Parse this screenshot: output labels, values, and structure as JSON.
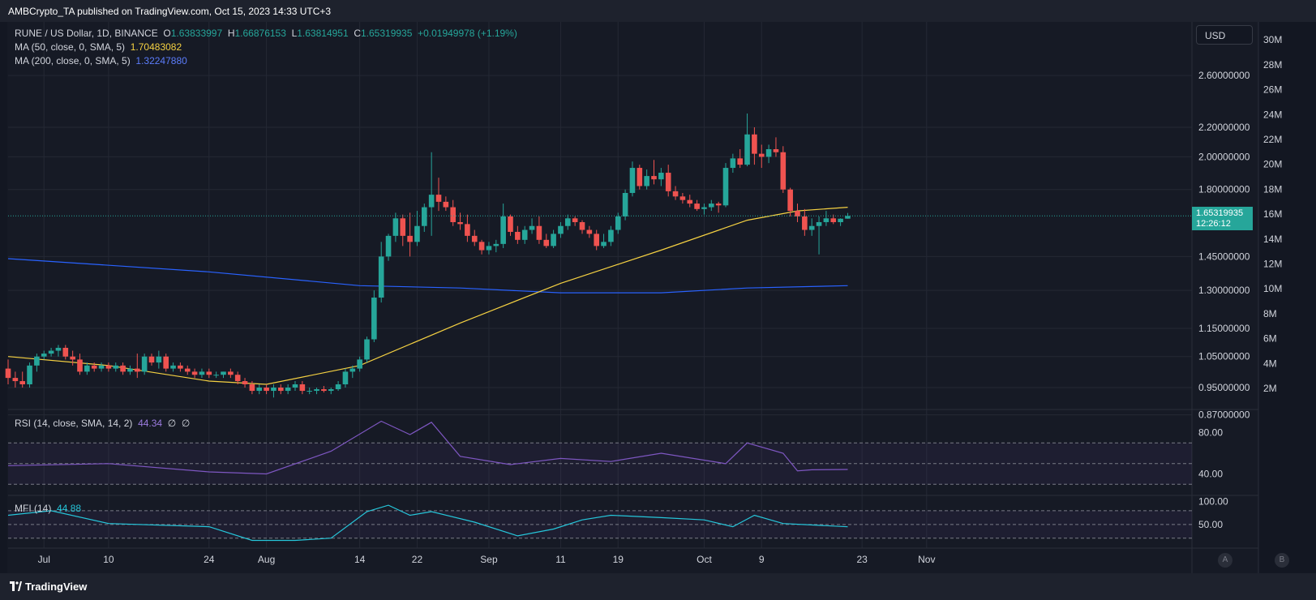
{
  "header": {
    "published_text": "AMBCrypto_TA published on TradingView.com, Oct 15, 2023 14:33 UTC+3"
  },
  "legend": {
    "symbol": "RUNE / US Dollar, 1D, BINANCE",
    "o_label": "O",
    "o_value": "1.63833997",
    "h_label": "H",
    "h_value": "1.66876153",
    "l_label": "L",
    "l_value": "1.63814951",
    "c_label": "C",
    "c_value": "1.65319935",
    "change": "+0.01949978 (+1.19%)",
    "ma50_label": "MA (50, close, 0, SMA, 5)",
    "ma50_value": "1.70483082",
    "ma200_label": "MA (200, close, 0, SMA, 5)",
    "ma200_value": "1.32247880"
  },
  "rsi_legend": {
    "label": "RSI (14, close, SMA, 14, 2)",
    "value": "44.34",
    "extra1": "∅",
    "extra2": "∅"
  },
  "mfi_legend": {
    "label": "MFI (14)",
    "value": "44.88"
  },
  "currency_button": "USD",
  "last_price": {
    "price": "1.65319935",
    "countdown": "12:26:12"
  },
  "footer": {
    "logo_text": "TradingView"
  },
  "scale_buttons": {
    "a": "A",
    "b": "B"
  },
  "colors": {
    "up": "#26a69a",
    "down": "#ef5350",
    "ma50": "#f5d142",
    "ma200": "#2962ff",
    "rsi": "#7e57c2",
    "mfi": "#26c6da",
    "background": "#161a25"
  },
  "chart_data": {
    "type": "candlestick",
    "price_axis": {
      "ticks": [
        0.87,
        0.95,
        1.05,
        1.15,
        1.3,
        1.45,
        1.8,
        2.0,
        2.2,
        2.6
      ],
      "scale": "log"
    },
    "volume_axis": {
      "ticks": [
        "2M",
        "4M",
        "6M",
        "8M",
        "10M",
        "12M",
        "14M",
        "16M",
        "18M",
        "20M",
        "22M",
        "24M",
        "26M",
        "28M",
        "30M"
      ]
    },
    "x_axis": {
      "labels": [
        "Jul",
        "10",
        "24",
        "Aug",
        "14",
        "22",
        "Sep",
        "11",
        "19",
        "Oct",
        "9",
        "23",
        "Nov"
      ]
    },
    "candles": [
      {
        "date": "2023-06-26",
        "o": 1.01,
        "h": 1.04,
        "l": 0.96,
        "c": 0.98
      },
      {
        "date": "2023-06-27",
        "o": 0.98,
        "h": 1.0,
        "l": 0.95,
        "c": 0.97
      },
      {
        "date": "2023-06-28",
        "o": 0.97,
        "h": 1.0,
        "l": 0.95,
        "c": 0.96
      },
      {
        "date": "2023-06-29",
        "o": 0.96,
        "h": 1.03,
        "l": 0.95,
        "c": 1.02
      },
      {
        "date": "2023-06-30",
        "o": 1.02,
        "h": 1.06,
        "l": 1.0,
        "c": 1.05
      },
      {
        "date": "2023-07-01",
        "o": 1.05,
        "h": 1.07,
        "l": 1.04,
        "c": 1.06
      },
      {
        "date": "2023-07-02",
        "o": 1.06,
        "h": 1.08,
        "l": 1.05,
        "c": 1.07
      },
      {
        "date": "2023-07-03",
        "o": 1.07,
        "h": 1.09,
        "l": 1.05,
        "c": 1.08
      },
      {
        "date": "2023-07-04",
        "o": 1.08,
        "h": 1.09,
        "l": 1.04,
        "c": 1.05
      },
      {
        "date": "2023-07-05",
        "o": 1.05,
        "h": 1.07,
        "l": 1.02,
        "c": 1.04
      },
      {
        "date": "2023-07-06",
        "o": 1.04,
        "h": 1.06,
        "l": 0.99,
        "c": 1.0
      },
      {
        "date": "2023-07-07",
        "o": 1.0,
        "h": 1.03,
        "l": 0.99,
        "c": 1.02
      },
      {
        "date": "2023-07-08",
        "o": 1.02,
        "h": 1.03,
        "l": 1.0,
        "c": 1.01
      },
      {
        "date": "2023-07-09",
        "o": 1.01,
        "h": 1.03,
        "l": 1.0,
        "c": 1.02
      },
      {
        "date": "2023-07-10",
        "o": 1.02,
        "h": 1.03,
        "l": 1.0,
        "c": 1.01
      },
      {
        "date": "2023-07-11",
        "o": 1.01,
        "h": 1.03,
        "l": 1.0,
        "c": 1.02
      },
      {
        "date": "2023-07-12",
        "o": 1.02,
        "h": 1.03,
        "l": 0.99,
        "c": 1.0
      },
      {
        "date": "2023-07-13",
        "o": 1.0,
        "h": 1.02,
        "l": 0.99,
        "c": 1.01
      },
      {
        "date": "2023-07-14",
        "o": 1.01,
        "h": 1.06,
        "l": 0.98,
        "c": 1.0
      },
      {
        "date": "2023-07-15",
        "o": 1.0,
        "h": 1.06,
        "l": 0.99,
        "c": 1.05
      },
      {
        "date": "2023-07-16",
        "o": 1.05,
        "h": 1.06,
        "l": 1.02,
        "c": 1.03
      },
      {
        "date": "2023-07-17",
        "o": 1.03,
        "h": 1.07,
        "l": 1.01,
        "c": 1.05
      },
      {
        "date": "2023-07-18",
        "o": 1.05,
        "h": 1.06,
        "l": 1.0,
        "c": 1.01
      },
      {
        "date": "2023-07-19",
        "o": 1.01,
        "h": 1.03,
        "l": 1.0,
        "c": 1.02
      },
      {
        "date": "2023-07-20",
        "o": 1.02,
        "h": 1.03,
        "l": 1.0,
        "c": 1.01
      },
      {
        "date": "2023-07-21",
        "o": 1.01,
        "h": 1.02,
        "l": 0.99,
        "c": 1.0
      },
      {
        "date": "2023-07-22",
        "o": 1.0,
        "h": 1.01,
        "l": 0.98,
        "c": 0.99
      },
      {
        "date": "2023-07-23",
        "o": 0.99,
        "h": 1.01,
        "l": 0.98,
        "c": 1.0
      },
      {
        "date": "2023-07-24",
        "o": 1.0,
        "h": 1.01,
        "l": 0.98,
        "c": 0.99
      },
      {
        "date": "2023-07-25",
        "o": 0.99,
        "h": 1.0,
        "l": 0.98,
        "c": 0.99
      },
      {
        "date": "2023-07-26",
        "o": 0.99,
        "h": 1.0,
        "l": 0.98,
        "c": 1.0
      },
      {
        "date": "2023-07-27",
        "o": 1.0,
        "h": 1.01,
        "l": 0.98,
        "c": 0.99
      },
      {
        "date": "2023-07-28",
        "o": 0.99,
        "h": 1.0,
        "l": 0.96,
        "c": 0.97
      },
      {
        "date": "2023-07-29",
        "o": 0.97,
        "h": 0.98,
        "l": 0.95,
        "c": 0.96
      },
      {
        "date": "2023-07-30",
        "o": 0.96,
        "h": 0.97,
        "l": 0.93,
        "c": 0.94
      },
      {
        "date": "2023-07-31",
        "o": 0.94,
        "h": 0.96,
        "l": 0.93,
        "c": 0.95
      },
      {
        "date": "2023-08-01",
        "o": 0.95,
        "h": 0.96,
        "l": 0.93,
        "c": 0.94
      },
      {
        "date": "2023-08-02",
        "o": 0.94,
        "h": 0.96,
        "l": 0.92,
        "c": 0.95
      },
      {
        "date": "2023-08-03",
        "o": 0.95,
        "h": 0.96,
        "l": 0.93,
        "c": 0.94
      },
      {
        "date": "2023-08-04",
        "o": 0.94,
        "h": 0.96,
        "l": 0.93,
        "c": 0.95
      },
      {
        "date": "2023-08-05",
        "o": 0.95,
        "h": 0.97,
        "l": 0.94,
        "c": 0.96
      },
      {
        "date": "2023-08-06",
        "o": 0.96,
        "h": 0.97,
        "l": 0.93,
        "c": 0.94
      },
      {
        "date": "2023-08-07",
        "o": 0.94,
        "h": 0.95,
        "l": 0.93,
        "c": 0.94
      },
      {
        "date": "2023-08-08",
        "o": 0.94,
        "h": 0.95,
        "l": 0.93,
        "c": 0.945
      },
      {
        "date": "2023-08-09",
        "o": 0.945,
        "h": 0.955,
        "l": 0.935,
        "c": 0.94
      },
      {
        "date": "2023-08-10",
        "o": 0.94,
        "h": 0.95,
        "l": 0.93,
        "c": 0.945
      },
      {
        "date": "2023-08-11",
        "o": 0.945,
        "h": 0.97,
        "l": 0.94,
        "c": 0.96
      },
      {
        "date": "2023-08-12",
        "o": 0.96,
        "h": 1.01,
        "l": 0.95,
        "c": 1.0
      },
      {
        "date": "2023-08-13",
        "o": 1.0,
        "h": 1.02,
        "l": 0.98,
        "c": 1.01
      },
      {
        "date": "2023-08-14",
        "o": 1.01,
        "h": 1.05,
        "l": 1.0,
        "c": 1.04
      },
      {
        "date": "2023-08-15",
        "o": 1.04,
        "h": 1.12,
        "l": 1.03,
        "c": 1.11
      },
      {
        "date": "2023-08-16",
        "o": 1.11,
        "h": 1.3,
        "l": 1.1,
        "c": 1.27
      },
      {
        "date": "2023-08-17",
        "o": 1.27,
        "h": 1.52,
        "l": 1.25,
        "c": 1.45
      },
      {
        "date": "2023-08-18",
        "o": 1.45,
        "h": 1.56,
        "l": 1.43,
        "c": 1.55
      },
      {
        "date": "2023-08-19",
        "o": 1.55,
        "h": 1.67,
        "l": 1.52,
        "c": 1.64
      },
      {
        "date": "2023-08-20",
        "o": 1.64,
        "h": 1.66,
        "l": 1.5,
        "c": 1.55
      },
      {
        "date": "2023-08-21",
        "o": 1.55,
        "h": 1.67,
        "l": 1.45,
        "c": 1.52
      },
      {
        "date": "2023-08-22",
        "o": 1.52,
        "h": 1.68,
        "l": 1.5,
        "c": 1.6
      },
      {
        "date": "2023-08-23",
        "o": 1.6,
        "h": 1.72,
        "l": 1.57,
        "c": 1.7
      },
      {
        "date": "2023-08-24",
        "o": 1.7,
        "h": 2.03,
        "l": 1.55,
        "c": 1.77
      },
      {
        "date": "2023-08-25",
        "o": 1.77,
        "h": 1.87,
        "l": 1.68,
        "c": 1.73
      },
      {
        "date": "2023-08-26",
        "o": 1.73,
        "h": 1.76,
        "l": 1.68,
        "c": 1.7
      },
      {
        "date": "2023-08-27",
        "o": 1.7,
        "h": 1.74,
        "l": 1.6,
        "c": 1.62
      },
      {
        "date": "2023-08-28",
        "o": 1.62,
        "h": 1.67,
        "l": 1.58,
        "c": 1.61
      },
      {
        "date": "2023-08-29",
        "o": 1.61,
        "h": 1.66,
        "l": 1.52,
        "c": 1.55
      },
      {
        "date": "2023-08-30",
        "o": 1.55,
        "h": 1.58,
        "l": 1.5,
        "c": 1.52
      },
      {
        "date": "2023-08-31",
        "o": 1.52,
        "h": 1.53,
        "l": 1.46,
        "c": 1.48
      },
      {
        "date": "2023-09-01",
        "o": 1.48,
        "h": 1.52,
        "l": 1.46,
        "c": 1.5
      },
      {
        "date": "2023-09-02",
        "o": 1.5,
        "h": 1.53,
        "l": 1.47,
        "c": 1.51
      },
      {
        "date": "2023-09-03",
        "o": 1.51,
        "h": 1.72,
        "l": 1.49,
        "c": 1.65
      },
      {
        "date": "2023-09-04",
        "o": 1.65,
        "h": 1.66,
        "l": 1.55,
        "c": 1.57
      },
      {
        "date": "2023-09-05",
        "o": 1.57,
        "h": 1.6,
        "l": 1.51,
        "c": 1.53
      },
      {
        "date": "2023-09-06",
        "o": 1.53,
        "h": 1.6,
        "l": 1.51,
        "c": 1.58
      },
      {
        "date": "2023-09-07",
        "o": 1.58,
        "h": 1.64,
        "l": 1.56,
        "c": 1.6
      },
      {
        "date": "2023-09-08",
        "o": 1.6,
        "h": 1.65,
        "l": 1.51,
        "c": 1.53
      },
      {
        "date": "2023-09-09",
        "o": 1.53,
        "h": 1.56,
        "l": 1.49,
        "c": 1.5
      },
      {
        "date": "2023-09-10",
        "o": 1.5,
        "h": 1.58,
        "l": 1.49,
        "c": 1.56
      },
      {
        "date": "2023-09-11",
        "o": 1.56,
        "h": 1.62,
        "l": 1.54,
        "c": 1.6
      },
      {
        "date": "2023-09-12",
        "o": 1.6,
        "h": 1.66,
        "l": 1.58,
        "c": 1.64
      },
      {
        "date": "2023-09-13",
        "o": 1.64,
        "h": 1.65,
        "l": 1.6,
        "c": 1.62
      },
      {
        "date": "2023-09-14",
        "o": 1.62,
        "h": 1.63,
        "l": 1.56,
        "c": 1.58
      },
      {
        "date": "2023-09-15",
        "o": 1.58,
        "h": 1.6,
        "l": 1.54,
        "c": 1.56
      },
      {
        "date": "2023-09-16",
        "o": 1.56,
        "h": 1.58,
        "l": 1.48,
        "c": 1.5
      },
      {
        "date": "2023-09-17",
        "o": 1.5,
        "h": 1.56,
        "l": 1.49,
        "c": 1.52
      },
      {
        "date": "2023-09-18",
        "o": 1.52,
        "h": 1.6,
        "l": 1.5,
        "c": 1.58
      },
      {
        "date": "2023-09-19",
        "o": 1.58,
        "h": 1.67,
        "l": 1.56,
        "c": 1.65
      },
      {
        "date": "2023-09-20",
        "o": 1.65,
        "h": 1.8,
        "l": 1.63,
        "c": 1.78
      },
      {
        "date": "2023-09-21",
        "o": 1.78,
        "h": 1.97,
        "l": 1.76,
        "c": 1.93
      },
      {
        "date": "2023-09-22",
        "o": 1.93,
        "h": 1.95,
        "l": 1.8,
        "c": 1.82
      },
      {
        "date": "2023-09-23",
        "o": 1.82,
        "h": 1.92,
        "l": 1.8,
        "c": 1.88
      },
      {
        "date": "2023-09-24",
        "o": 1.88,
        "h": 1.98,
        "l": 1.83,
        "c": 1.86
      },
      {
        "date": "2023-09-25",
        "o": 1.86,
        "h": 1.93,
        "l": 1.82,
        "c": 1.9
      },
      {
        "date": "2023-09-26",
        "o": 1.9,
        "h": 1.95,
        "l": 1.76,
        "c": 1.79
      },
      {
        "date": "2023-09-27",
        "o": 1.79,
        "h": 1.82,
        "l": 1.74,
        "c": 1.76
      },
      {
        "date": "2023-09-28",
        "o": 1.76,
        "h": 1.78,
        "l": 1.72,
        "c": 1.74
      },
      {
        "date": "2023-09-29",
        "o": 1.74,
        "h": 1.77,
        "l": 1.7,
        "c": 1.72
      },
      {
        "date": "2023-09-30",
        "o": 1.72,
        "h": 1.74,
        "l": 1.68,
        "c": 1.69
      },
      {
        "date": "2023-10-01",
        "o": 1.69,
        "h": 1.72,
        "l": 1.66,
        "c": 1.7
      },
      {
        "date": "2023-10-02",
        "o": 1.7,
        "h": 1.74,
        "l": 1.68,
        "c": 1.72
      },
      {
        "date": "2023-10-03",
        "o": 1.72,
        "h": 1.73,
        "l": 1.67,
        "c": 1.71
      },
      {
        "date": "2023-10-04",
        "o": 1.71,
        "h": 1.96,
        "l": 1.7,
        "c": 1.93
      },
      {
        "date": "2023-10-05",
        "o": 1.93,
        "h": 2.02,
        "l": 1.9,
        "c": 1.99
      },
      {
        "date": "2023-10-06",
        "o": 1.99,
        "h": 2.05,
        "l": 1.93,
        "c": 1.95
      },
      {
        "date": "2023-10-07",
        "o": 1.95,
        "h": 2.3,
        "l": 1.94,
        "c": 2.15
      },
      {
        "date": "2023-10-08",
        "o": 2.15,
        "h": 2.2,
        "l": 1.95,
        "c": 2.02
      },
      {
        "date": "2023-10-09",
        "o": 2.02,
        "h": 2.08,
        "l": 1.93,
        "c": 2.0
      },
      {
        "date": "2023-10-10",
        "o": 2.0,
        "h": 2.08,
        "l": 1.96,
        "c": 2.05
      },
      {
        "date": "2023-10-11",
        "o": 2.05,
        "h": 2.13,
        "l": 2.0,
        "c": 2.03
      },
      {
        "date": "2023-10-12",
        "o": 2.03,
        "h": 2.07,
        "l": 1.78,
        "c": 1.8
      },
      {
        "date": "2023-10-13",
        "o": 1.8,
        "h": 1.81,
        "l": 1.65,
        "c": 1.68
      },
      {
        "date": "2023-10-14",
        "o": 1.68,
        "h": 1.72,
        "l": 1.62,
        "c": 1.65
      },
      {
        "date": "2023-10-15",
        "o": 1.65,
        "h": 1.69,
        "l": 1.55,
        "c": 1.58
      },
      {
        "date": "2023-10-16",
        "o": 1.58,
        "h": 1.64,
        "l": 1.55,
        "c": 1.6
      },
      {
        "date": "2023-10-17",
        "o": 1.6,
        "h": 1.65,
        "l": 1.46,
        "c": 1.62
      },
      {
        "date": "2023-10-18",
        "o": 1.62,
        "h": 1.68,
        "l": 1.6,
        "c": 1.64
      },
      {
        "date": "2023-10-19",
        "o": 1.64,
        "h": 1.66,
        "l": 1.61,
        "c": 1.62
      },
      {
        "date": "2023-10-20",
        "o": 1.62,
        "h": 1.64,
        "l": 1.6,
        "c": 1.638
      },
      {
        "date": "2023-10-21",
        "o": 1.63834,
        "h": 1.66876,
        "l": 1.63815,
        "c": 1.6532
      }
    ],
    "series": [
      {
        "name": "MA (50, close, 0, SMA, 5)",
        "type": "line",
        "x": [
          "2023-06-26",
          "2023-07-10",
          "2023-07-24",
          "2023-08-01",
          "2023-08-14",
          "2023-08-28",
          "2023-09-11",
          "2023-09-25",
          "2023-10-07",
          "2023-10-14",
          "2023-10-21"
        ],
        "y": [
          1.05,
          1.02,
          0.97,
          0.96,
          1.02,
          1.17,
          1.33,
          1.48,
          1.63,
          1.68,
          1.7
        ]
      },
      {
        "name": "MA (200, close, 0, SMA, 5)",
        "type": "line",
        "x": [
          "2023-06-26",
          "2023-07-24",
          "2023-08-14",
          "2023-08-28",
          "2023-09-11",
          "2023-09-25",
          "2023-10-07",
          "2023-10-21"
        ],
        "y": [
          1.44,
          1.38,
          1.32,
          1.31,
          1.29,
          1.29,
          1.31,
          1.32
        ]
      },
      {
        "name": "RSI (14, close, SMA, 14, 2)",
        "type": "line",
        "ylim": [
          20,
          100
        ],
        "bands": [
          70,
          50,
          30
        ],
        "x": [
          "2023-06-26",
          "2023-07-10",
          "2023-07-24",
          "2023-08-01",
          "2023-08-10",
          "2023-08-17",
          "2023-08-21",
          "2023-08-24",
          "2023-08-28",
          "2023-09-04",
          "2023-09-11",
          "2023-09-18",
          "2023-09-25",
          "2023-10-04",
          "2023-10-07",
          "2023-10-12",
          "2023-10-14",
          "2023-10-16",
          "2023-10-21"
        ],
        "y": [
          48,
          50,
          42,
          40,
          62,
          91,
          78,
          90,
          57,
          49,
          55,
          52,
          60,
          50,
          70,
          60,
          43,
          44,
          44.34
        ]
      },
      {
        "name": "MFI (14)",
        "type": "line",
        "ylim": [
          0,
          110
        ],
        "bands": [
          80,
          50,
          20
        ],
        "x": [
          "2023-06-26",
          "2023-07-02",
          "2023-07-10",
          "2023-07-24",
          "2023-07-30",
          "2023-08-05",
          "2023-08-10",
          "2023-08-15",
          "2023-08-18",
          "2023-08-21",
          "2023-08-24",
          "2023-08-30",
          "2023-09-05",
          "2023-09-10",
          "2023-09-14",
          "2023-09-18",
          "2023-09-25",
          "2023-10-01",
          "2023-10-05",
          "2023-10-08",
          "2023-10-12",
          "2023-10-17",
          "2023-10-21"
        ],
        "y": [
          70,
          80,
          52,
          45,
          15,
          15,
          20,
          78,
          92,
          70,
          78,
          55,
          25,
          40,
          60,
          70,
          65,
          60,
          45,
          70,
          52,
          48,
          44.88
        ]
      }
    ]
  }
}
